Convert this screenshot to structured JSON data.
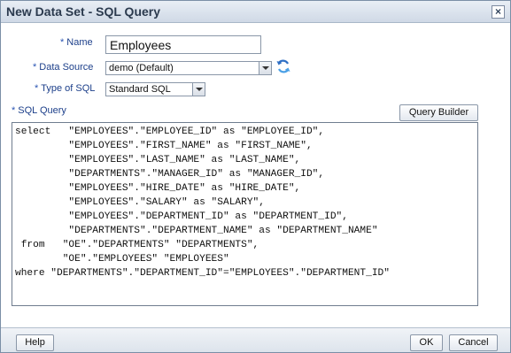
{
  "dialog": {
    "title": "New Data Set - SQL Query",
    "close_glyph": "×"
  },
  "form": {
    "required_mark": "*",
    "name_label": "Name",
    "name_value": "Employees",
    "data_source_label": "Data Source",
    "data_source_value": "demo (Default)",
    "type_label": "Type of SQL",
    "type_value": "Standard SQL",
    "sql_label": "SQL Query",
    "query_builder_label": "Query Builder",
    "sql_text": "select   \"EMPLOYEES\".\"EMPLOYEE_ID\" as \"EMPLOYEE_ID\",\n         \"EMPLOYEES\".\"FIRST_NAME\" as \"FIRST_NAME\",\n         \"EMPLOYEES\".\"LAST_NAME\" as \"LAST_NAME\",\n         \"DEPARTMENTS\".\"MANAGER_ID\" as \"MANAGER_ID\",\n         \"EMPLOYEES\".\"HIRE_DATE\" as \"HIRE_DATE\",\n         \"EMPLOYEES\".\"SALARY\" as \"SALARY\",\n         \"EMPLOYEES\".\"DEPARTMENT_ID\" as \"DEPARTMENT_ID\",\n         \"DEPARTMENTS\".\"DEPARTMENT_NAME\" as \"DEPARTMENT_NAME\"\n from   \"OE\".\"DEPARTMENTS\" \"DEPARTMENTS\",\n        \"OE\".\"EMPLOYEES\" \"EMPLOYEES\"\nwhere \"DEPARTMENTS\".\"DEPARTMENT_ID\"=\"EMPLOYEES\".\"DEPARTMENT_ID\""
  },
  "footer": {
    "help_label": "Help",
    "ok_label": "OK",
    "cancel_label": "Cancel"
  },
  "icons": {
    "refresh": "refresh-icon",
    "close": "close-icon",
    "dropdown": "chevron-down-icon"
  },
  "colors": {
    "label_blue": "#1c3f8a",
    "titlebar": "#cfd9e6"
  }
}
